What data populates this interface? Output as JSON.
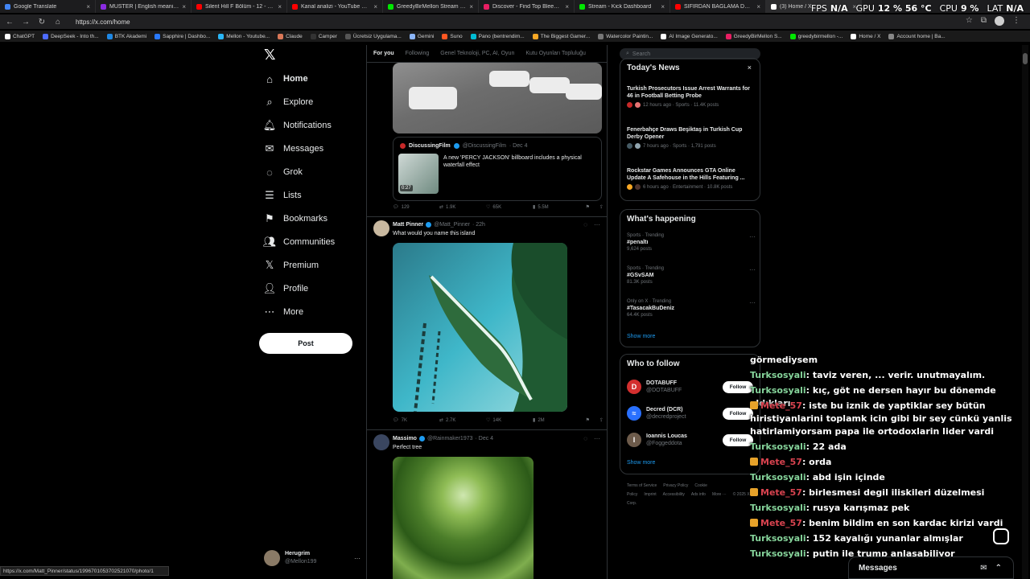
{
  "browser": {
    "tabs": [
      {
        "label": "Google Translate",
        "color": "#4285f4"
      },
      {
        "label": "MUSTER | English meaning - Cam",
        "color": "#8a2be2"
      },
      {
        "label": "Silent Hill F Bölüm - 12 - O İkili ca",
        "color": "#ff0000"
      },
      {
        "label": "Kanal analizi - YouTube Studio",
        "color": "#ff0000"
      },
      {
        "label": "GreedyBirMellon Stream - Watch",
        "color": "#00e701"
      },
      {
        "label": "Discover - Find Top Bleeps, Stream",
        "color": "#e91e63"
      },
      {
        "label": "Stream - Kick Dashboard",
        "color": "#00e701"
      },
      {
        "label": "SIFIRDAN BAĞLAMA DERSİ 3 (EN",
        "color": "#ff0000"
      },
      {
        "label": "(3) Home / X",
        "color": "#ffffff",
        "active": true
      }
    ],
    "tab_close": "×",
    "url": "https://x.com/home",
    "hud": [
      {
        "label": "FPS",
        "value": "N/A"
      },
      {
        "label": "GPU",
        "value": "12 % 56 °C"
      },
      {
        "label": "CPU",
        "value": "9 %"
      },
      {
        "label": "LAT",
        "value": "N/A"
      }
    ],
    "bookmarks": [
      {
        "label": "ChatGPT",
        "color": "#ffffff"
      },
      {
        "label": "DeepSeek - Into th...",
        "color": "#4d6bfe"
      },
      {
        "label": "BTK Akademi",
        "color": "#1e88e5"
      },
      {
        "label": "Sapphire | Dashbo...",
        "color": "#2979ff"
      },
      {
        "label": "Mellon - Youtube...",
        "color": "#29b6f6"
      },
      {
        "label": "Claude",
        "color": "#d97757"
      },
      {
        "label": "Camper",
        "color": "#333333"
      },
      {
        "label": "Ücretsiz Uygulama...",
        "color": "#555555"
      },
      {
        "label": "Gemini",
        "color": "#8ab4f8"
      },
      {
        "label": "Suno",
        "color": "#ff5722"
      },
      {
        "label": "Pano (bentrendim...",
        "color": "#00bcd4"
      },
      {
        "label": "The Biggest Gamer...",
        "color": "#f9a825"
      },
      {
        "label": "Watercolor Paintin...",
        "color": "#777777"
      },
      {
        "label": "AI Image Generato...",
        "color": "#ffffff"
      },
      {
        "label": "GreedyBirMellon S...",
        "color": "#e91e63"
      },
      {
        "label": "greedybirmellon -...",
        "color": "#00e701"
      },
      {
        "label": "Home / X",
        "color": "#ffffff"
      },
      {
        "label": "Account home | Ba...",
        "color": "#888888"
      }
    ],
    "status_url": "https://x.com/Matt_Pinner/status/1996701053702521070/photo/1"
  },
  "leftnav": {
    "logo": "𝕏",
    "items": [
      {
        "label": "Home",
        "icon": "⌂"
      },
      {
        "label": "Explore",
        "icon": "⌕"
      },
      {
        "label": "Notifications",
        "icon": "🔔︎"
      },
      {
        "label": "Messages",
        "icon": "✉"
      },
      {
        "label": "Grok",
        "icon": "◌"
      },
      {
        "label": "Lists",
        "icon": "☰"
      },
      {
        "label": "Bookmarks",
        "icon": "⚑"
      },
      {
        "label": "Communities",
        "icon": "👥︎"
      },
      {
        "label": "Premium",
        "icon": "𝕏"
      },
      {
        "label": "Profile",
        "icon": "👤︎"
      },
      {
        "label": "More",
        "icon": "⋯"
      }
    ],
    "post_label": "Post",
    "account": {
      "name": "Herugrim",
      "handle": "@Mellon199",
      "more": "···"
    }
  },
  "feed": {
    "tabs": [
      "For you",
      "Following",
      "Genel Teknoloji, PC, AI, Oyun",
      "Kutu Oyunları Topluluğu"
    ],
    "tweet1": {
      "quote": {
        "name": "DiscussingFilm",
        "handle": "@DiscussingFilm",
        "date": "· Dec 4",
        "duration": "0:27",
        "text": "A new 'PERCY JACKSON' billboard includes a physical waterfall effect"
      },
      "actions": {
        "reply": "129",
        "retweet": "1.9K",
        "like": "65K",
        "views": "5.5M"
      }
    },
    "tweet2": {
      "name": "Matt Pinner",
      "handle": "@Matt_Pinner",
      "time": "· 22h",
      "text": "What would you name this island",
      "actions": {
        "reply": "7K",
        "retweet": "2.7K",
        "like": "14K",
        "views": "2M"
      }
    },
    "tweet3": {
      "name": "Massimo",
      "handle": "@Rainmaker1973",
      "time": "· Dec 4",
      "text": "Perfect tree"
    }
  },
  "right": {
    "search_placeholder": "Search",
    "news": {
      "title": "Today's News",
      "close": "×",
      "items": [
        {
          "headline": "Turkish Prosecutors Issue Arrest Warrants for 46 in Football Betting Probe",
          "meta": "12 hours ago · Sports · 11.4K posts"
        },
        {
          "headline": "Fenerbahçe Draws Beşiktaş in Turkish Cup Derby Opener",
          "meta": "7 hours ago · Sports · 1,791 posts"
        },
        {
          "headline": "Rockstar Games Announces GTA Online Update A Safehouse in the Hills Featuring ...",
          "meta": "6 hours ago · Entertainment · 10.8K posts"
        }
      ]
    },
    "happening": {
      "title": "What's happening",
      "items": [
        {
          "context": "Sports · Trending",
          "tag": "#penaltı",
          "posts": "9,624 posts"
        },
        {
          "context": "Sports · Trending",
          "tag": "#GSvSAM",
          "posts": "81.3K posts"
        },
        {
          "context": "Only on X · Trending",
          "tag": "#TasacakBuDeniz",
          "posts": "64.4K posts"
        }
      ],
      "show_more": "Show more"
    },
    "who": {
      "title": "Who to follow",
      "items": [
        {
          "name": "DOTABUFF",
          "handle": "@DOTABUFF",
          "initial": "D",
          "color": "#d32f2f"
        },
        {
          "name": "Decred (DCR)",
          "handle": "@decredproject",
          "initial": "≈",
          "color": "#2970ff"
        },
        {
          "name": "Ioannis Loucas",
          "handle": "@Foggeddota",
          "initial": "I",
          "color": "#6d5b4b"
        }
      ],
      "follow_label": "Follow",
      "show_more": "Show more"
    },
    "footer": [
      "Terms of Service",
      "Privacy Policy",
      "Cookie Policy",
      "Imprint",
      "Accessibility",
      "Ads info",
      "More ···",
      "© 2025 X Corp."
    ]
  },
  "chat": [
    {
      "user": "",
      "text": "görmediysem",
      "type": "cont"
    },
    {
      "user": "Turksosyali",
      "text": ": taviz veren, ... verir. unutmayalım.",
      "type": "t"
    },
    {
      "user": "Turksosyali",
      "text": ": kıç, göt ne dersen hayır bu dönemde aldıkları",
      "type": "t"
    },
    {
      "user": "Mete_57",
      "text": ": iste bu iznik de yaptiklar sey bütün hiristiyanlarini toplamk icin gibi bir sey cünkü yanlis hatirlamiyorsam papa ile ortodoxlarin lider vardi",
      "type": "m"
    },
    {
      "user": "Turksosyali",
      "text": ": 22 ada",
      "type": "t"
    },
    {
      "user": "Mete_57",
      "text": ": orda",
      "type": "m"
    },
    {
      "user": "Turksosyali",
      "text": ": abd işin içinde",
      "type": "t"
    },
    {
      "user": "Mete_57",
      "text": ": birlesmesi degil iliskileri düzelmesi",
      "type": "m"
    },
    {
      "user": "Turksosyali",
      "text": ": rusya karışmaz pek",
      "type": "t"
    },
    {
      "user": "Mete_57",
      "text": ": benim bildim en son kardac kirizi vardi",
      "type": "m"
    },
    {
      "user": "Turksosyali",
      "text": ": 152 kayalığı yunanlar almışlar",
      "type": "t"
    },
    {
      "user": "Turksosyali",
      "text": ": putin ile trump anlaşabiliyor",
      "type": "t"
    }
  ],
  "messages_drawer": {
    "label": "Messages"
  }
}
